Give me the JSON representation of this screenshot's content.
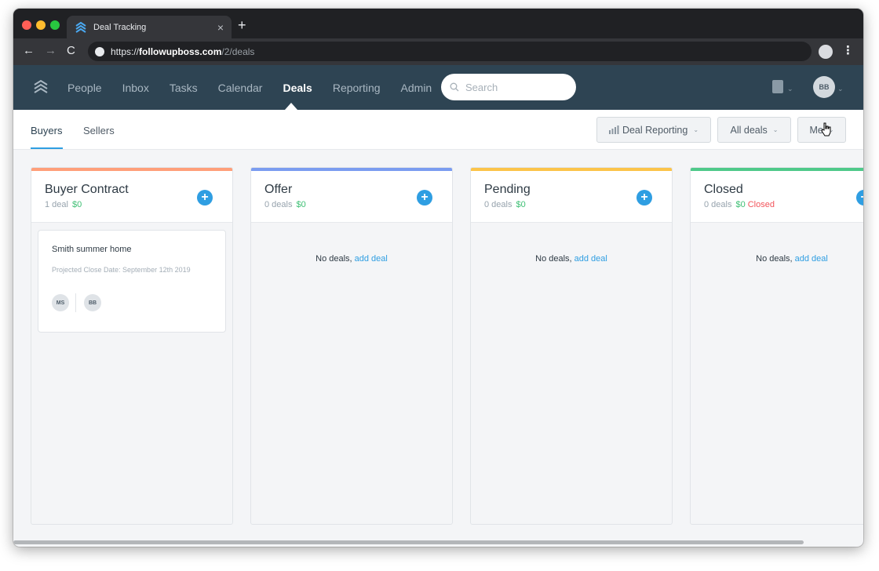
{
  "browser": {
    "tab_title": "Deal Tracking",
    "tab_close": "×",
    "new_tab": "+",
    "url_scheme": "https://",
    "url_host": "followupboss.com",
    "url_path": "/2/deals",
    "back": "←",
    "forward": "→",
    "reload": "C",
    "menu": "⋮"
  },
  "nav": {
    "items": [
      "People",
      "Inbox",
      "Tasks",
      "Calendar",
      "Deals",
      "Reporting",
      "Admin"
    ],
    "active": "Deals",
    "search_placeholder": "Search",
    "user_initials": "BB",
    "chevron": "⌄"
  },
  "subheader": {
    "tabs": [
      "Buyers",
      "Sellers"
    ],
    "active_tab": "Buyers",
    "deal_reporting_label": "Deal Reporting",
    "all_deals_label": "All deals",
    "me_label": "Me",
    "chevron": "⌄"
  },
  "columns": [
    {
      "title": "Buyer Contract",
      "count": "1 deal",
      "amount": "$0",
      "color": "#ff9f7a",
      "empty_text": "",
      "add_link": ""
    },
    {
      "title": "Offer",
      "count": "0 deals",
      "amount": "$0",
      "color": "#7b9cf0",
      "empty_text": "No deals,",
      "add_link": "add deal"
    },
    {
      "title": "Pending",
      "count": "0 deals",
      "amount": "$0",
      "color": "#fcc44a",
      "empty_text": "No deals,",
      "add_link": "add deal"
    },
    {
      "title": "Closed",
      "count": "0 deals",
      "amount": "$0",
      "extra": "Closed",
      "color": "#4fc98a",
      "empty_text": "No deals,",
      "add_link": "add deal"
    }
  ],
  "deal_card": {
    "name": "Smith summer home",
    "date": "Projected Close Date: September 12th 2019",
    "people": [
      "MS",
      "BB"
    ]
  },
  "add_symbol": "+"
}
